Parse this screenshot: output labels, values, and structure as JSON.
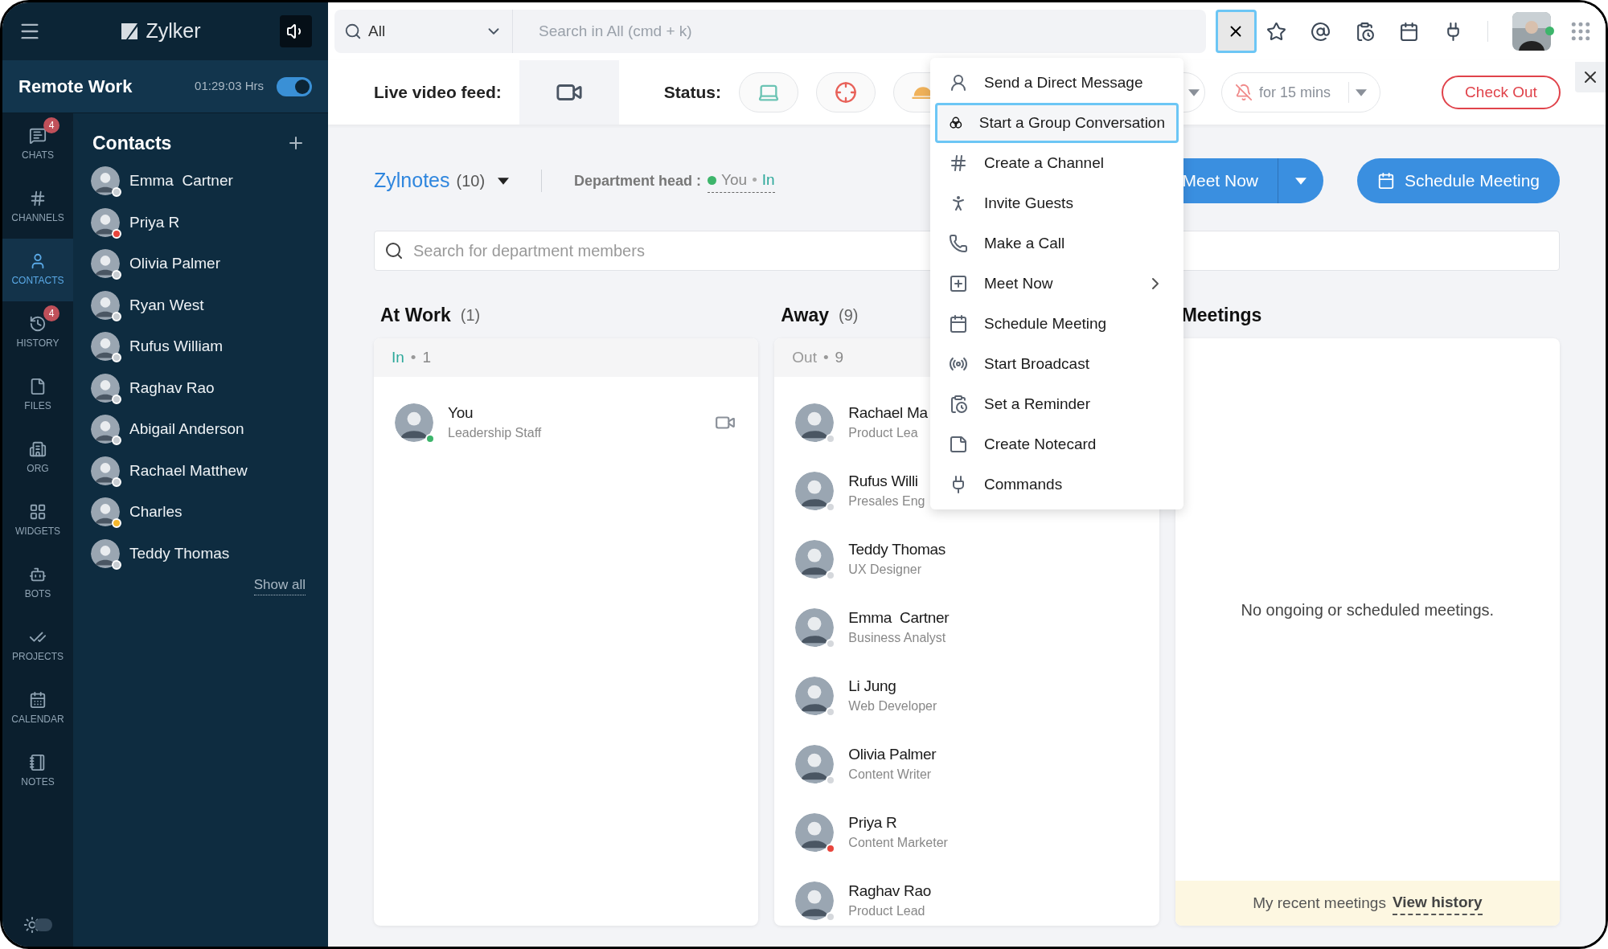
{
  "sidebar": {
    "brand": "Zylker",
    "work_mode": {
      "title": "Remote Work",
      "timer": "01:29:03 Hrs",
      "on": true
    },
    "nav": [
      {
        "label": "CHATS",
        "badge": "4",
        "selected": false
      },
      {
        "label": "CHANNELS",
        "selected": false
      },
      {
        "label": "CONTACTS",
        "selected": true
      },
      {
        "label": "HISTORY",
        "badge": "4",
        "selected": false
      },
      {
        "label": "FILES",
        "selected": false
      },
      {
        "label": "ORG",
        "selected": false
      },
      {
        "label": "WIDGETS",
        "selected": false
      },
      {
        "label": "BOTS",
        "selected": false
      },
      {
        "label": "PROJECTS",
        "selected": false
      },
      {
        "label": "CALENDAR",
        "selected": false
      },
      {
        "label": "NOTES",
        "selected": false
      }
    ],
    "theme_toggle": {
      "on": false
    },
    "contacts": {
      "title": "Contacts",
      "items": [
        {
          "name": "Emma  Cartner",
          "color": "#c9ced3"
        },
        {
          "name": "Priya R",
          "color": "#e8453c"
        },
        {
          "name": "Olivia Palmer",
          "color": "#c9ced3"
        },
        {
          "name": "Ryan West",
          "color": "#c9ced3"
        },
        {
          "name": "Rufus William",
          "color": "#c9ced3"
        },
        {
          "name": "Raghav Rao",
          "color": "#c9ced3"
        },
        {
          "name": "Abigail Anderson",
          "color": "#c9ced3"
        },
        {
          "name": "Rachael Matthew",
          "color": "#c9ced3"
        },
        {
          "name": "Charles",
          "color": "#f5b82e"
        },
        {
          "name": "Teddy Thomas",
          "color": "#c9ced3"
        }
      ],
      "show_all": "Show all"
    }
  },
  "search": {
    "scope": "All",
    "placeholder": "Search in All (cmd + k)"
  },
  "toolbar": {
    "live_video_label": "Live video feed:",
    "status_label": "Status:",
    "status_options": [
      {
        "kind": "laptop"
      },
      {
        "kind": "target"
      },
      {
        "kind": "cloche"
      }
    ],
    "dnd": "for 15 mins",
    "check_out": "Check Out"
  },
  "department": {
    "name": "Zylnotes",
    "count": "(10)",
    "head_label": "Department head :",
    "head_name": "You",
    "head_separator": "•",
    "head_status": "In",
    "member_search_placeholder": "Search for department members",
    "meet_now": "Meet Now",
    "schedule": "Schedule Meeting"
  },
  "columns": [
    {
      "title": "At Work",
      "count": "(1)",
      "group_label": "In",
      "group_separator": "•",
      "group_count": "1",
      "members": [
        {
          "name": "You",
          "role": "Leadership Staff",
          "color": "#3db56b",
          "video": true
        }
      ]
    },
    {
      "title": "Away",
      "count": "(9)",
      "group_label": "Out",
      "group_separator": "•",
      "group_count": "9",
      "members": [
        {
          "name": "Rachael Ma",
          "role": "Product Lea",
          "color": "#d5d8dc",
          "video": false
        },
        {
          "name": "Rufus Willi",
          "role": "Presales Eng",
          "color": "#d5d8dc",
          "video": false
        },
        {
          "name": "Teddy Thomas",
          "role": "UX Designer",
          "color": "#d5d8dc",
          "video": false
        },
        {
          "name": "Emma  Cartner",
          "role": "Business Analyst",
          "color": "#d5d8dc",
          "video": false
        },
        {
          "name": "Li Jung",
          "role": "Web Developer",
          "color": "#d5d8dc",
          "video": false
        },
        {
          "name": "Olivia Palmer",
          "role": "Content Writer",
          "color": "#d5d8dc",
          "video": false
        },
        {
          "name": "Priya R",
          "role": "Content Marketer",
          "color": "#e8453c",
          "video": false
        },
        {
          "name": "Raghav Rao",
          "role": "Product Lead",
          "color": "#d5d8dc",
          "video": false
        }
      ]
    }
  ],
  "meetings": {
    "title": "Meetings",
    "empty": "No ongoing or scheduled meetings.",
    "footer": "My recent meetings",
    "link": "View history"
  },
  "menu": [
    {
      "label": "Send a Direct Message",
      "selected": false,
      "submenu": false
    },
    {
      "label": "Start a Group Conversation",
      "selected": true,
      "submenu": false
    },
    {
      "label": "Create a Channel",
      "selected": false,
      "submenu": false
    },
    {
      "label": "Invite Guests",
      "selected": false,
      "submenu": false
    },
    {
      "label": "Make a Call",
      "selected": false,
      "submenu": false
    },
    {
      "label": "Meet Now",
      "selected": false,
      "submenu": true
    },
    {
      "label": "Schedule Meeting",
      "selected": false,
      "submenu": false
    },
    {
      "label": "Start Broadcast",
      "selected": false,
      "submenu": false
    },
    {
      "label": "Set a Reminder",
      "selected": false,
      "submenu": false
    },
    {
      "label": "Create Notecard",
      "selected": false,
      "submenu": false
    },
    {
      "label": "Commands",
      "selected": false,
      "submenu": false
    }
  ]
}
